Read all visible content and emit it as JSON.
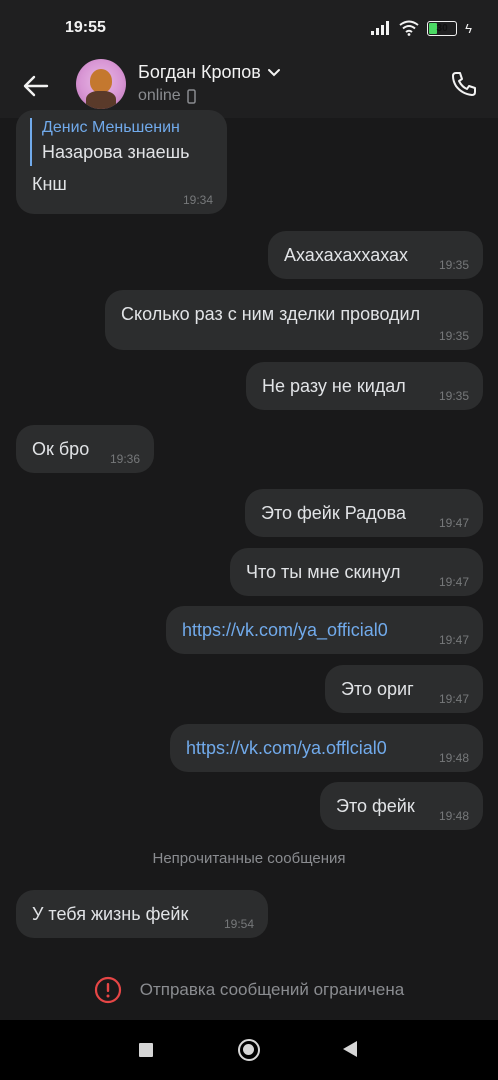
{
  "status_bar": {
    "time": "19:55",
    "battery": "30",
    "icons": [
      "signal-icon",
      "wifi-icon",
      "battery-icon",
      "charging-icon"
    ]
  },
  "header": {
    "contact_name": "Богдан Кропов",
    "status": "online",
    "icons": [
      "back-arrow-icon",
      "chevron-down-icon",
      "mobile-icon",
      "phone-icon"
    ]
  },
  "messages": [
    {
      "dir": "in",
      "reply_author": "Денис Меньшенин",
      "reply_text": "Назарова знаешь",
      "text": "Кнш",
      "time": "19:34"
    },
    {
      "dir": "out",
      "text": "Ахахахаххахах",
      "time": "19:35"
    },
    {
      "dir": "out",
      "text": "Сколько раз с ним зделки проводил",
      "time": "19:35"
    },
    {
      "dir": "out",
      "text": "Не разу не кидал",
      "time": "19:35"
    },
    {
      "dir": "in",
      "text": "Ок бро",
      "time": "19:36"
    },
    {
      "dir": "out",
      "text": "Это фейк Радова",
      "time": "19:47"
    },
    {
      "dir": "out",
      "text": "Что ты мне скинул",
      "time": "19:47"
    },
    {
      "dir": "out",
      "text": "https://vk.com/ya_official0",
      "time": "19:47",
      "link": true
    },
    {
      "dir": "out",
      "text": "Это ориг",
      "time": "19:47"
    },
    {
      "dir": "out",
      "text": "https://vk.com/ya.offlcial0",
      "time": "19:48",
      "link": true
    },
    {
      "dir": "out",
      "text": "Это фейк",
      "time": "19:48"
    },
    {
      "dir": "in",
      "text": "У тебя жизнь фейк",
      "time": "19:54"
    }
  ],
  "unread_divider": "Непрочитанные сообщения",
  "restriction_text": "Отправка сообщений ограничена",
  "colors": {
    "background": "#19191a",
    "bubble": "#2c2d2e",
    "link": "#71aaeb",
    "alert": "#e64646"
  }
}
